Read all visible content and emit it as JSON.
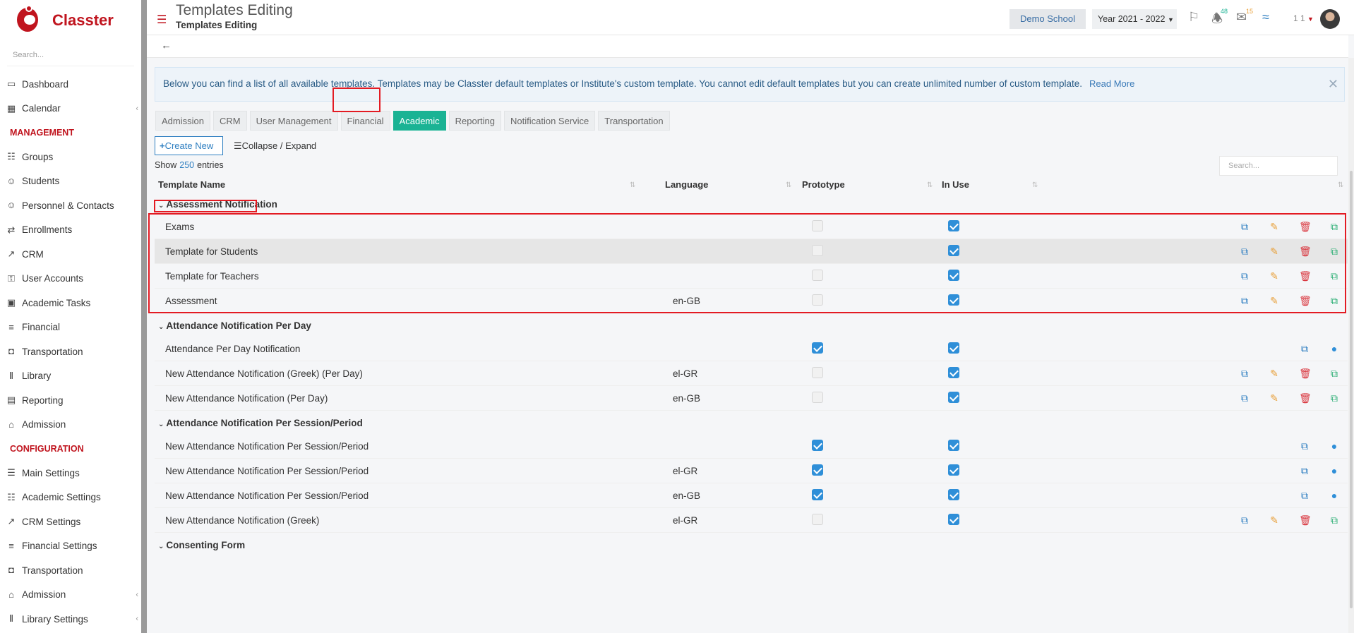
{
  "app": {
    "name": "Classter"
  },
  "sidebar": {
    "search_placeholder": "Search...",
    "items_top": [
      {
        "label": "Dashboard",
        "icon": "laptop-icon"
      },
      {
        "label": "Calendar",
        "icon": "calendar-icon"
      }
    ],
    "management_label": "MANAGEMENT",
    "management": [
      {
        "label": "Groups",
        "icon": "groups-icon"
      },
      {
        "label": "Students",
        "icon": "students-icon"
      },
      {
        "label": "Personnel & Contacts",
        "icon": "personnel-icon"
      },
      {
        "label": "Enrollments",
        "icon": "enrollments-icon"
      },
      {
        "label": "CRM",
        "icon": "crm-icon"
      },
      {
        "label": "User Accounts",
        "icon": "key-icon"
      },
      {
        "label": "Academic Tasks",
        "icon": "tasks-icon"
      },
      {
        "label": "Financial",
        "icon": "coins-icon"
      },
      {
        "label": "Transportation",
        "icon": "bus-icon"
      },
      {
        "label": "Library",
        "icon": "books-icon"
      },
      {
        "label": "Reporting",
        "icon": "printer-icon"
      },
      {
        "label": "Admission",
        "icon": "bank-icon"
      }
    ],
    "configuration_label": "CONFIGURATION",
    "configuration": [
      {
        "label": "Main Settings",
        "icon": "sliders-icon"
      },
      {
        "label": "Academic Settings",
        "icon": "groups-icon"
      },
      {
        "label": "CRM Settings",
        "icon": "crm-icon"
      },
      {
        "label": "Financial Settings",
        "icon": "coins-icon"
      },
      {
        "label": "Transportation",
        "icon": "bus-icon"
      },
      {
        "label": "Admission",
        "icon": "bank-icon"
      },
      {
        "label": "Library Settings",
        "icon": "books-icon"
      }
    ]
  },
  "topbar": {
    "title": "Templates Editing",
    "subtitle": "Templates Editing",
    "school": "Demo School",
    "year": "Year 2021 - 2022",
    "notifications_count": "48",
    "messages_count": "15",
    "user_label": "1 1"
  },
  "info": {
    "text": "Below you can find a list of all available templates. Templates may be Classter default templates or Institute's custom template. You cannot edit default templates but you can create unlimited number of custom template.",
    "link": "Read More"
  },
  "tabs": [
    "Admission",
    "CRM",
    "User Management",
    "Financial",
    "Academic",
    "Reporting",
    "Notification Service",
    "Transportation"
  ],
  "active_tab": "Academic",
  "toolbar": {
    "create_new": "Create New",
    "collapse_expand": "Collapse / Expand",
    "show_label": "Show",
    "entries_count": "250",
    "entries_label": "entries",
    "search_placeholder": "Search..."
  },
  "table": {
    "headers": [
      "Template Name",
      "Language",
      "Prototype",
      "In Use"
    ],
    "groups": [
      {
        "name": "Assessment Notification",
        "rows": [
          {
            "name": "Exams",
            "language": "",
            "prototype": false,
            "in_use": true,
            "actions": "full"
          },
          {
            "name": "Template for Students",
            "language": "",
            "prototype": false,
            "in_use": true,
            "actions": "full"
          },
          {
            "name": "Template for Teachers",
            "language": "",
            "prototype": false,
            "in_use": true,
            "actions": "full"
          },
          {
            "name": "Assessment",
            "language": "en-GB",
            "prototype": false,
            "in_use": true,
            "actions": "full"
          }
        ]
      },
      {
        "name": "Attendance Notification Per Day",
        "rows": [
          {
            "name": "Attendance Per Day Notification",
            "language": "",
            "prototype": true,
            "in_use": true,
            "actions": "limited"
          },
          {
            "name": "New Attendance Notification (Greek) (Per Day)",
            "language": "el-GR",
            "prototype": false,
            "in_use": true,
            "actions": "full"
          },
          {
            "name": "New Attendance Notification (Per Day)",
            "language": "en-GB",
            "prototype": false,
            "in_use": true,
            "actions": "full"
          }
        ]
      },
      {
        "name": "Attendance Notification Per Session/Period",
        "rows": [
          {
            "name": "New Attendance Notification Per Session/Period",
            "language": "",
            "prototype": true,
            "in_use": true,
            "actions": "limited"
          },
          {
            "name": "New Attendance Notification Per Session/Period",
            "language": "el-GR",
            "prototype": true,
            "in_use": true,
            "actions": "limited"
          },
          {
            "name": "New Attendance Notification Per Session/Period",
            "language": "en-GB",
            "prototype": true,
            "in_use": true,
            "actions": "limited"
          },
          {
            "name": "New Attendance Notification (Greek)",
            "language": "el-GR",
            "prototype": false,
            "in_use": true,
            "actions": "full"
          }
        ]
      },
      {
        "name": "Consenting Form",
        "rows": []
      }
    ]
  },
  "colors": {
    "brand": "#c0141e",
    "accent": "#1bb394",
    "link": "#2f7fc1",
    "highlight": "#e31b23"
  }
}
